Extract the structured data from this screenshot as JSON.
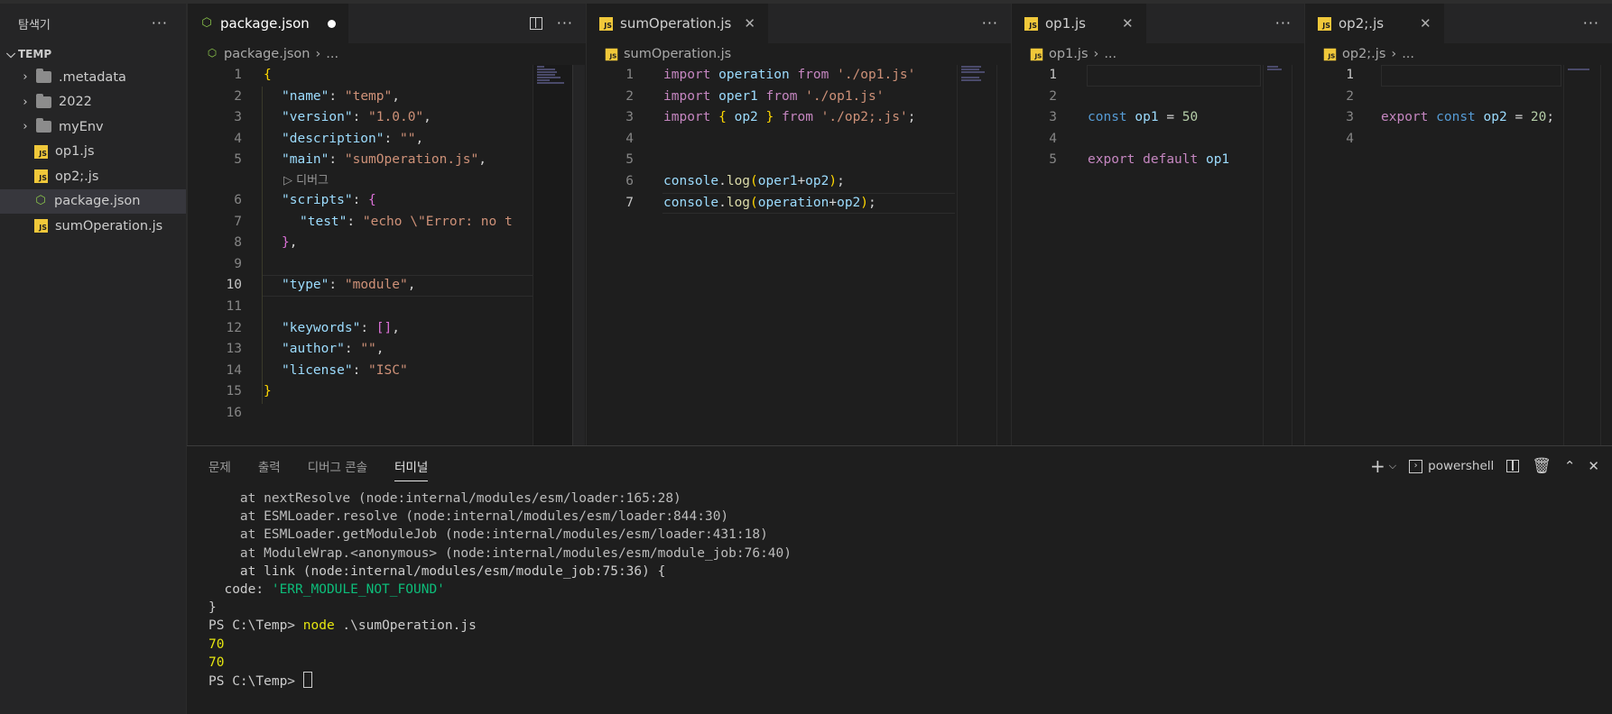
{
  "sidebar": {
    "title": "탐색기",
    "more": "···",
    "section": "TEMP",
    "items": [
      {
        "label": ".metadata",
        "type": "folder"
      },
      {
        "label": "2022",
        "type": "folder"
      },
      {
        "label": "myEnv",
        "type": "folder"
      },
      {
        "label": "op1.js",
        "type": "js"
      },
      {
        "label": "op2;.js",
        "type": "js"
      },
      {
        "label": "package.json",
        "type": "node"
      },
      {
        "label": "sumOperation.js",
        "type": "js"
      }
    ]
  },
  "panes": {
    "p1": {
      "tab": "package.json",
      "crumb": "package.json",
      "crumb_more": "...",
      "codelens": "디버그",
      "lines": [
        "1",
        "2",
        "3",
        "4",
        "5",
        "6",
        "7",
        "8",
        "9",
        "10",
        "11",
        "12",
        "13",
        "14",
        "15",
        "16"
      ]
    },
    "p2": {
      "tab": "sumOperation.js",
      "crumb": "sumOperation.js",
      "lines": [
        "1",
        "2",
        "3",
        "4",
        "5",
        "6",
        "7"
      ]
    },
    "p3": {
      "tab": "op1.js",
      "crumb": "op1.js",
      "crumb_more": "...",
      "lines": [
        "1",
        "2",
        "3",
        "4",
        "5"
      ]
    },
    "p4": {
      "tab": "op2;.js",
      "crumb": "op2;.js",
      "crumb_more": "...",
      "lines": [
        "1",
        "2",
        "3",
        "4"
      ]
    }
  },
  "code": {
    "pkg": {
      "brace_open": "{",
      "name_key": "\"name\"",
      "name_val": "\"temp\"",
      "version_key": "\"version\"",
      "version_val": "\"1.0.0\"",
      "desc_key": "\"description\"",
      "desc_val": "\"\"",
      "main_key": "\"main\"",
      "main_val": "\"sumOperation.js\"",
      "scripts_key": "\"scripts\"",
      "test_key": "\"test\"",
      "test_val": "\"echo \\\"Error: no t",
      "type_key": "\"type\"",
      "type_val": "\"module\"",
      "keywords_key": "\"keywords\"",
      "author_key": "\"author\"",
      "author_val": "\"\"",
      "license_key": "\"license\"",
      "license_val": "\"ISC\"",
      "brace_close": "}"
    },
    "sum": {
      "import": "import",
      "from": "from",
      "id_operation": "operation",
      "id_oper1": "oper1",
      "id_op2": "op2",
      "path1": "'./op1.js'",
      "path2": "'./op2;.js'",
      "console": "console",
      "log": "log"
    },
    "op1": {
      "const": "const",
      "name": "op1",
      "val": "50",
      "export": "export",
      "default": "default"
    },
    "op2": {
      "export": "export",
      "const": "const",
      "name": "op2",
      "val": "20"
    }
  },
  "panel": {
    "tabs": [
      "문제",
      "출력",
      "디버그 콘솔",
      "터미널"
    ],
    "shell": "powershell",
    "terminal": {
      "l1": "    at nextResolve (node:internal/modules/esm/loader:165:28)",
      "l2": "    at ESMLoader.resolve (node:internal/modules/esm/loader:844:30)",
      "l3": "    at ESMLoader.getModuleJob (node:internal/modules/esm/loader:431:18)",
      "l4": "    at ModuleWrap.<anonymous> (node:internal/modules/esm/module_job:76:40)",
      "l5": "    at link (node:internal/modules/esm/module_job:75:36) {",
      "code_label": "  code: ",
      "code_val": "'ERR_MODULE_NOT_FOUND'",
      "l7": "}",
      "prompt": "PS C:\\Temp> ",
      "cmd": "node",
      "cmd_arg": " .\\sumOperation.js",
      "out1": "70",
      "out2": "70"
    }
  }
}
